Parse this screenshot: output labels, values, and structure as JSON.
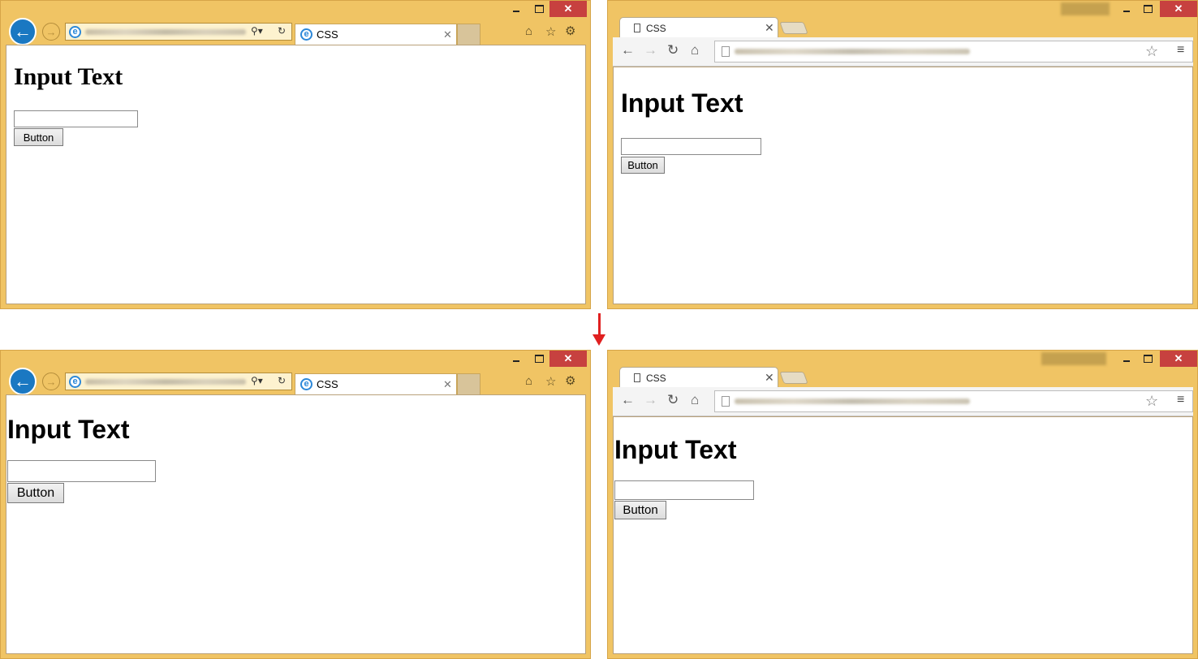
{
  "transition_arrow": {
    "color": "#e02020"
  },
  "windows": [
    {
      "id": "top-left",
      "browser": "ie",
      "tab_label": "CSS",
      "page": {
        "heading": "Input Text",
        "button_label": "Button"
      },
      "controls": {
        "close": "✕"
      }
    },
    {
      "id": "top-right",
      "browser": "chrome",
      "tab_label": "CSS",
      "page": {
        "heading": "Input Text",
        "button_label": "Button"
      },
      "controls": {
        "close": "✕"
      }
    },
    {
      "id": "bottom-left",
      "browser": "ie",
      "tab_label": "CSS",
      "page": {
        "heading": "Input Text",
        "button_label": "Button"
      },
      "controls": {
        "close": "✕"
      }
    },
    {
      "id": "bottom-right",
      "browser": "chrome",
      "tab_label": "CSS",
      "page": {
        "heading": "Input Text",
        "button_label": "Button"
      },
      "controls": {
        "close": "✕"
      }
    }
  ],
  "colors": {
    "frame": "#f0c464",
    "close_button": "#c7413f",
    "ie_back": "#1a78c2"
  }
}
